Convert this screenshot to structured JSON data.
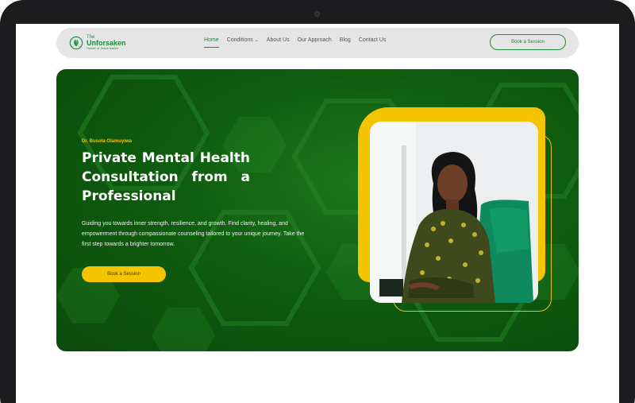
{
  "brand": {
    "logo_top": "The",
    "logo_name": "Unforsaken",
    "logo_sub": "House of Jesus Nation",
    "accent": "#1f8a3a",
    "highlight": "#f5c400",
    "hero_bg": "#0f5c0f"
  },
  "nav": {
    "items": [
      {
        "label": "Home",
        "active": true
      },
      {
        "label": "Conditions",
        "dropdown_icon": "chevron-down-icon"
      },
      {
        "label": "About Us"
      },
      {
        "label": "Our Approach"
      },
      {
        "label": "Blog"
      },
      {
        "label": "Contact Us"
      }
    ],
    "cta": "Book a Session"
  },
  "hero": {
    "author": "Dr. Busola Olamuyiwa",
    "headline": "Private Mental Health Consultation from a Professional",
    "description": "Guiding you towards inner strength, resilience, and growth. Find clarity, healing, and empowerment through compassionate counseling tailored to your unique journey. Take the first step towards a brighter tomorrow.",
    "cta": "Book a Session"
  }
}
